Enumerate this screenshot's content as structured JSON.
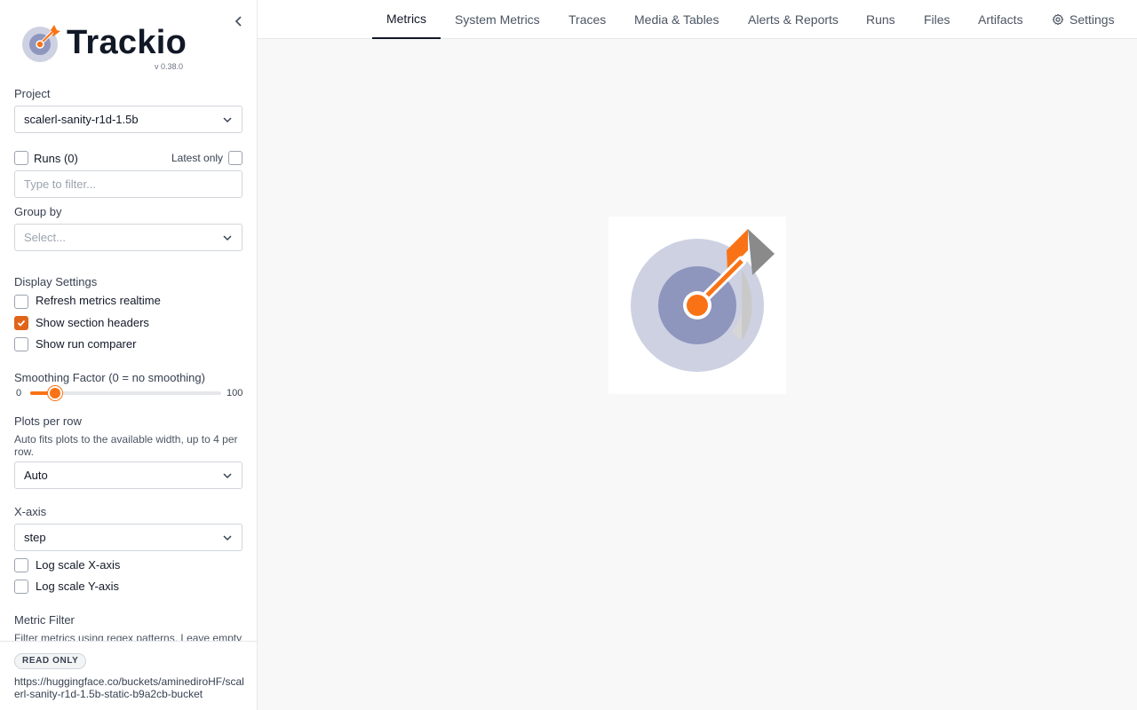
{
  "app": {
    "name": "Trackio",
    "version": "v 0.38.0"
  },
  "sidebar": {
    "project_label": "Project",
    "project_value": "scalerl-sanity-r1d-1.5b",
    "runs_label": "Runs (0)",
    "latest_only_label": "Latest only",
    "runs_filter_placeholder": "Type to filter...",
    "group_by_label": "Group by",
    "group_by_placeholder": "Select...",
    "display_settings_label": "Display Settings",
    "options": [
      {
        "label": "Refresh metrics realtime",
        "checked": false
      },
      {
        "label": "Show section headers",
        "checked": true
      },
      {
        "label": "Show run comparer",
        "checked": false
      }
    ],
    "smoothing": {
      "label": "Smoothing Factor (0 = no smoothing)",
      "min": "0",
      "max": "100",
      "value": 13
    },
    "plots_per_row": {
      "label": "Plots per row",
      "description": "Auto fits plots to the available width, up to 4 per row.",
      "value": "Auto"
    },
    "x_axis": {
      "label": "X-axis",
      "value": "step"
    },
    "log_scale": [
      {
        "label": "Log scale X-axis",
        "checked": false
      },
      {
        "label": "Log scale Y-axis",
        "checked": false
      }
    ],
    "metric_filter": {
      "label": "Metric Filter",
      "description": "Filter metrics using regex patterns. Leave empty"
    },
    "footer": {
      "badge": "READ ONLY",
      "url": "https://huggingface.co/buckets/aminediroHF/scalerl-sanity-r1d-1.5b-static-b9a2cb-bucket"
    }
  },
  "tabs": [
    {
      "label": "Metrics",
      "active": true
    },
    {
      "label": "System Metrics",
      "active": false
    },
    {
      "label": "Traces",
      "active": false
    },
    {
      "label": "Media & Tables",
      "active": false
    },
    {
      "label": "Alerts & Reports",
      "active": false
    },
    {
      "label": "Runs",
      "active": false
    },
    {
      "label": "Files",
      "active": false
    },
    {
      "label": "Artifacts",
      "active": false
    },
    {
      "label": "Settings",
      "active": false,
      "icon": "gear-icon"
    }
  ],
  "colors": {
    "accent": "#f97316",
    "checkbox_checked": "#e0651b",
    "target_outer": "#cdd1e2",
    "target_inner": "#8e96bd",
    "dart_grey": "#8a8a8a"
  }
}
